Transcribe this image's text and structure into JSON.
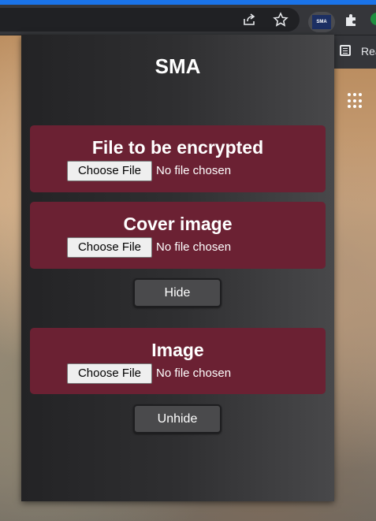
{
  "browser": {
    "icons": {
      "share": "share-icon",
      "bookmark": "star-icon",
      "extension": "sma-extension-icon",
      "extensions_menu": "puzzle-icon"
    },
    "extension_logo_text": "SMA",
    "reading_list_label": "Rea",
    "accent_color": "#1a73e8"
  },
  "popup": {
    "title": "SMA",
    "encrypt_card": {
      "title": "File to be encrypted",
      "choose_label": "Choose File",
      "status": "No file chosen"
    },
    "cover_card": {
      "title": "Cover image",
      "choose_label": "Choose File",
      "status": "No file chosen"
    },
    "hide_button": "Hide",
    "image_card": {
      "title": "Image",
      "choose_label": "Choose File",
      "status": "No file chosen"
    },
    "unhide_button": "Unhide",
    "card_color": "#6b2133"
  }
}
